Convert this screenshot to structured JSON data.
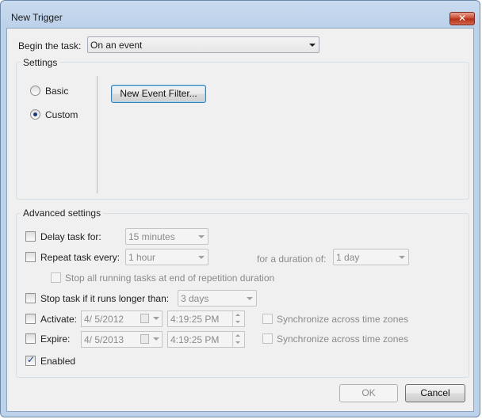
{
  "window": {
    "title": "New Trigger",
    "close_label": "✕"
  },
  "begin_task": {
    "label": "Begin the task:",
    "value": "On an event"
  },
  "settings": {
    "group_label": "Settings",
    "radio_basic": "Basic",
    "radio_custom": "Custom",
    "selected": "Custom",
    "new_event_filter": "New Event Filter..."
  },
  "advanced": {
    "group_label": "Advanced settings",
    "delay": {
      "label": "Delay task for:",
      "value": "15 minutes",
      "checked": false
    },
    "repeat": {
      "label": "Repeat task every:",
      "value": "1 hour",
      "checked": false,
      "duration_label": "for a duration of:",
      "duration_value": "1 day"
    },
    "stop_running": {
      "label": "Stop all running tasks at end of repetition duration",
      "checked": false
    },
    "stop_longer": {
      "label": "Stop task if it runs longer than:",
      "value": "3 days",
      "checked": false
    },
    "activate": {
      "label": "Activate:",
      "date": "4/  5/2012",
      "time": "4:19:25 PM",
      "sync_label": "Synchronize across time zones",
      "checked": false
    },
    "expire": {
      "label": "Expire:",
      "date": "4/  5/2013",
      "time": "4:19:25 PM",
      "sync_label": "Synchronize across time zones",
      "checked": false
    },
    "enabled": {
      "label": "Enabled",
      "checked": true,
      "check_glyph": "✓"
    }
  },
  "footer": {
    "ok_label": "OK",
    "cancel_label": "Cancel"
  }
}
